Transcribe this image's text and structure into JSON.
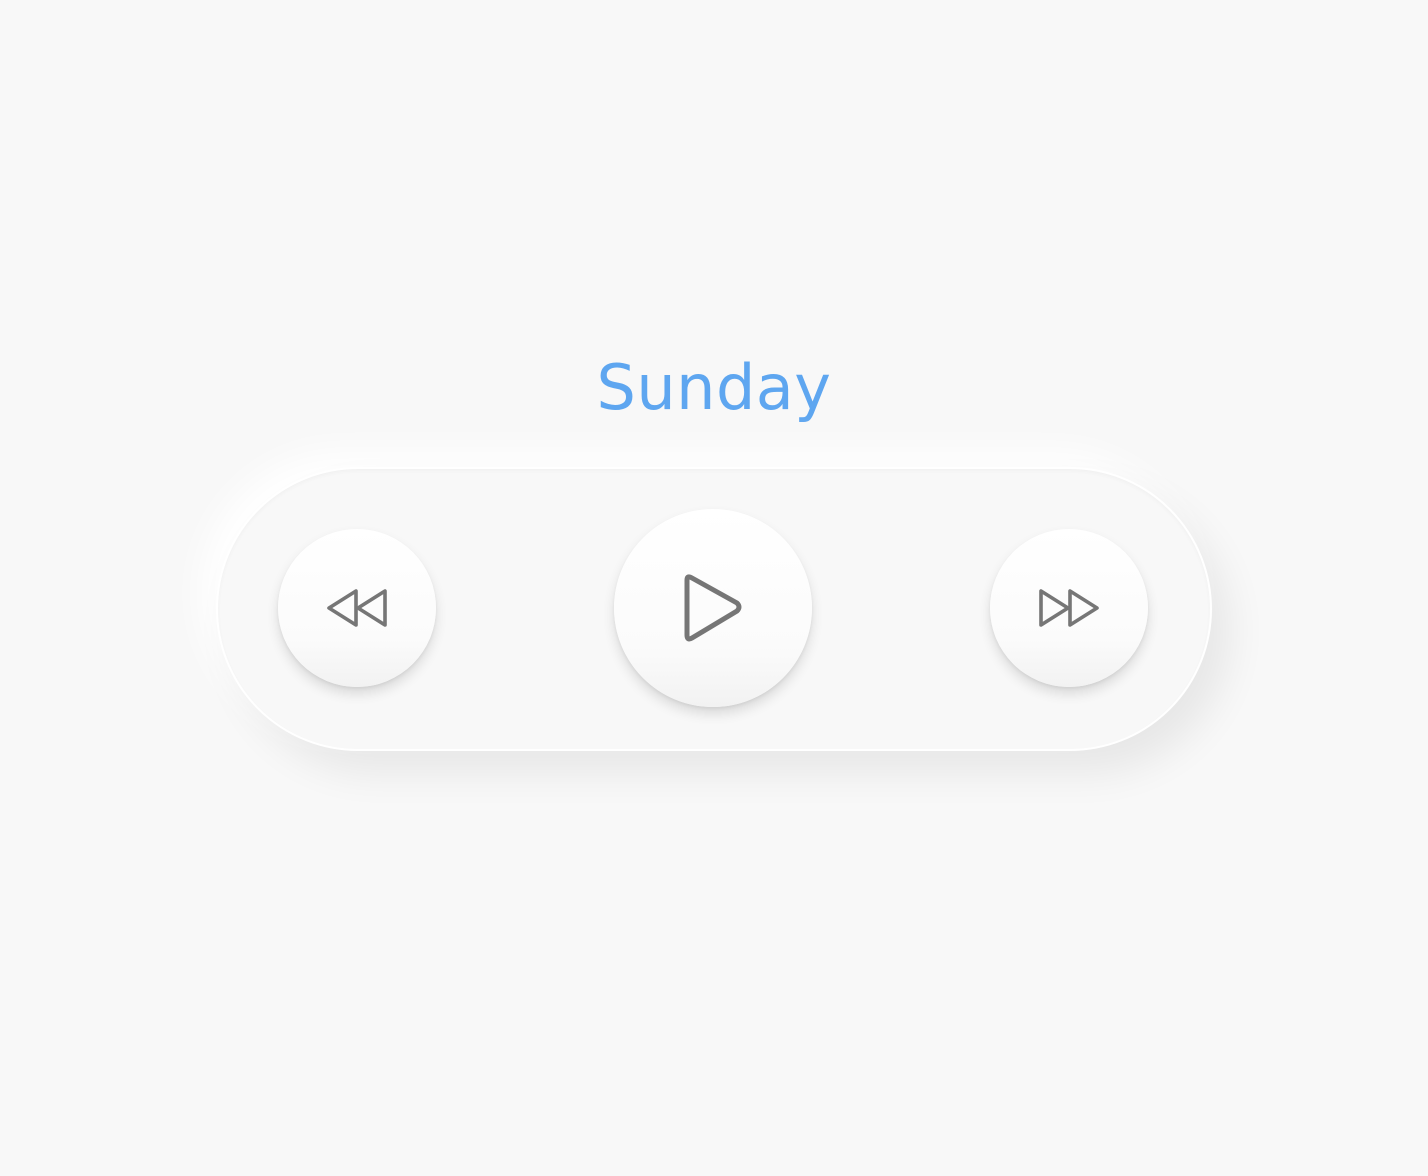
{
  "track": {
    "title": "Sunday"
  },
  "controls": {
    "rewind_icon": "rewind-icon",
    "play_icon": "play-icon",
    "forward_icon": "fast-forward-icon"
  },
  "colors": {
    "background": "#f8f8f8",
    "title": "#5ea6f0",
    "icon_stroke": "#767676"
  }
}
